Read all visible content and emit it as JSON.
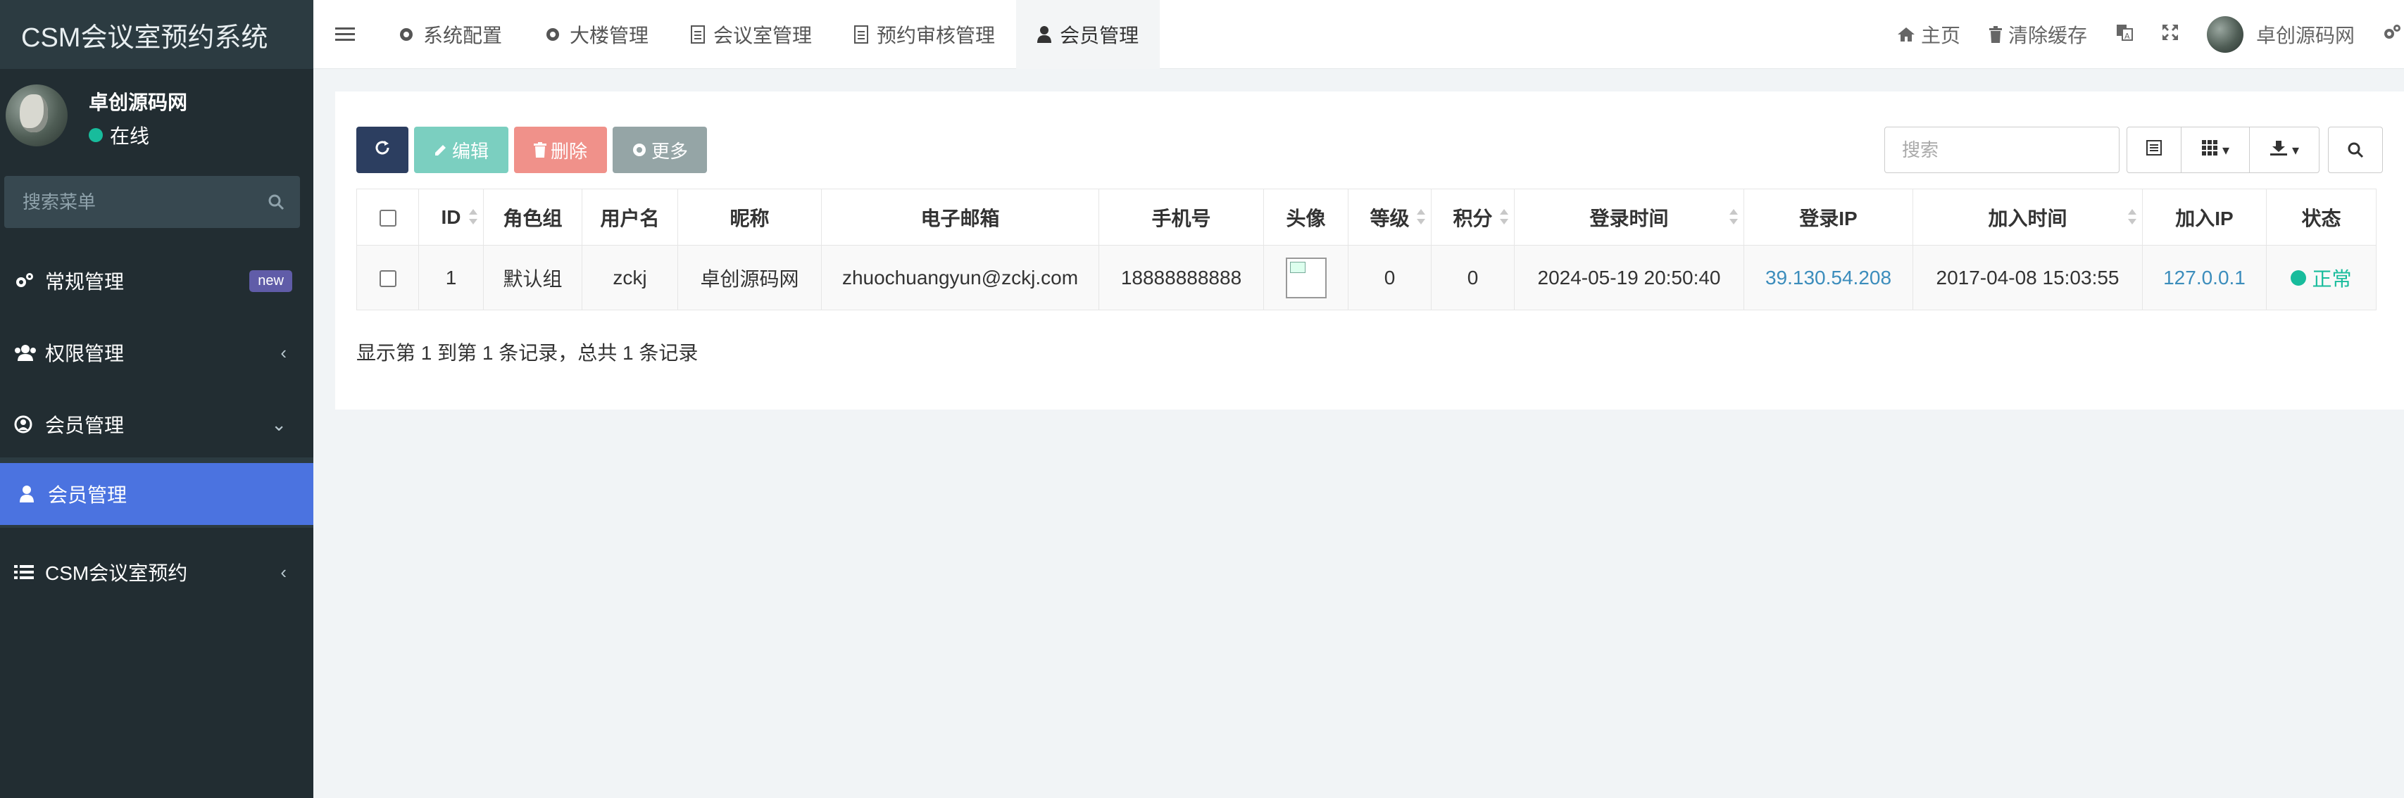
{
  "app": {
    "title": "CSM会议室预约系统"
  },
  "sidebar": {
    "user_name": "卓创源码网",
    "status": "在线",
    "search_placeholder": "搜索菜单",
    "items": [
      {
        "label": "常规管理",
        "badge": "new"
      },
      {
        "label": "权限管理"
      },
      {
        "label": "会员管理"
      },
      {
        "label": "会员管理"
      },
      {
        "label": "CSM会议室预约"
      }
    ]
  },
  "topnav": {
    "tabs": [
      "系统配置",
      "大楼管理",
      "会议室管理",
      "预约审核管理",
      "会员管理"
    ],
    "right": {
      "home": "主页",
      "clear_cache": "清除缓存",
      "user": "卓创源码网"
    }
  },
  "toolbar": {
    "edit": "编辑",
    "delete": "删除",
    "more": "更多",
    "search_placeholder": "搜索"
  },
  "table": {
    "headers": [
      "ID",
      "角色组",
      "用户名",
      "昵称",
      "电子邮箱",
      "手机号",
      "头像",
      "等级",
      "积分",
      "登录时间",
      "登录IP",
      "加入时间",
      "加入IP",
      "状态"
    ],
    "rows": [
      {
        "id": "1",
        "group": "默认组",
        "username": "zckj",
        "nickname": "卓创源码网",
        "email": "zhuochuangyun@zckj.com",
        "mobile": "18888888888",
        "level": "0",
        "score": "0",
        "login_time": "2024-05-19 20:50:40",
        "login_ip": "39.130.54.208",
        "join_time": "2017-04-08 15:03:55",
        "join_ip": "127.0.0.1",
        "status": "正常"
      }
    ]
  },
  "pagination": {
    "info": "显示第 1 到第 1 条记录，总共 1 条记录"
  },
  "colors": {
    "sidebar_bg": "#222d32",
    "active": "#4b73e0",
    "success": "#18bc9c",
    "link": "#3c8dbc"
  }
}
